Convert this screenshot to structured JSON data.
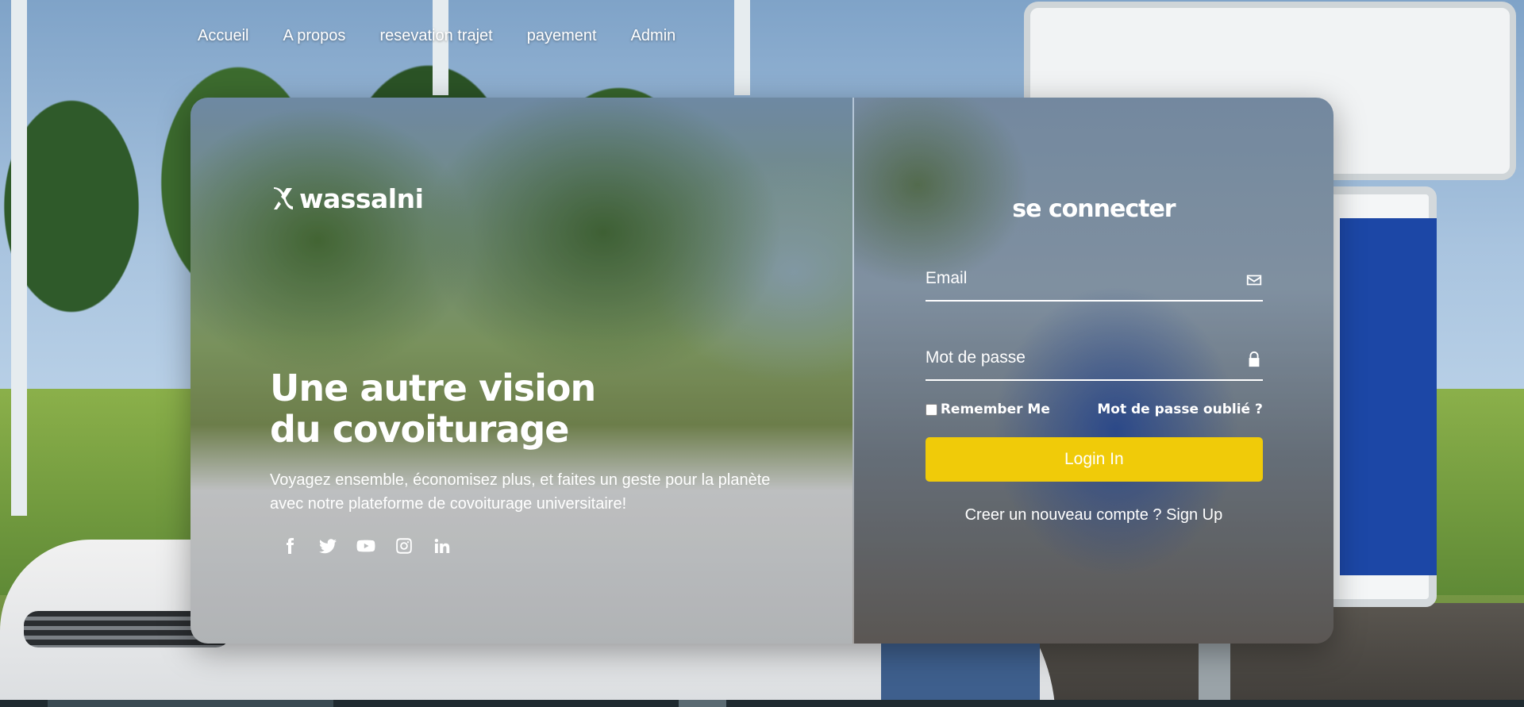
{
  "nav": {
    "items": [
      "Accueil",
      "A propos",
      "resevation trajet",
      "payement",
      "Admin"
    ]
  },
  "brand": {
    "name": "wassalni",
    "icon": "x-swoosh-logo-icon"
  },
  "hero": {
    "title_line1": "Une autre vision",
    "title_line2": "du covoiturage",
    "description": "Voyagez ensemble, économisez plus, et faites un geste pour la planète avec notre plateforme de covoiturage universitaire!"
  },
  "socials": [
    {
      "icon": "facebook-icon"
    },
    {
      "icon": "twitter-icon"
    },
    {
      "icon": "youtube-icon"
    },
    {
      "icon": "instagram-icon"
    },
    {
      "icon": "linkedin-icon"
    }
  ],
  "login": {
    "title": "se connecter",
    "email_placeholder": "Email",
    "email_icon": "envelope-icon",
    "password_placeholder": "Mot de passe",
    "password_icon": "lock-icon",
    "remember_label": "Remember Me",
    "forgot_label": "Mot de passe oublié ?",
    "submit_label": "Login In",
    "signup_prompt": "Creer un nouveau compte ? ",
    "signup_link": "Sign Up"
  },
  "colors": {
    "accent": "#f0cb09",
    "text": "#ffffff"
  }
}
